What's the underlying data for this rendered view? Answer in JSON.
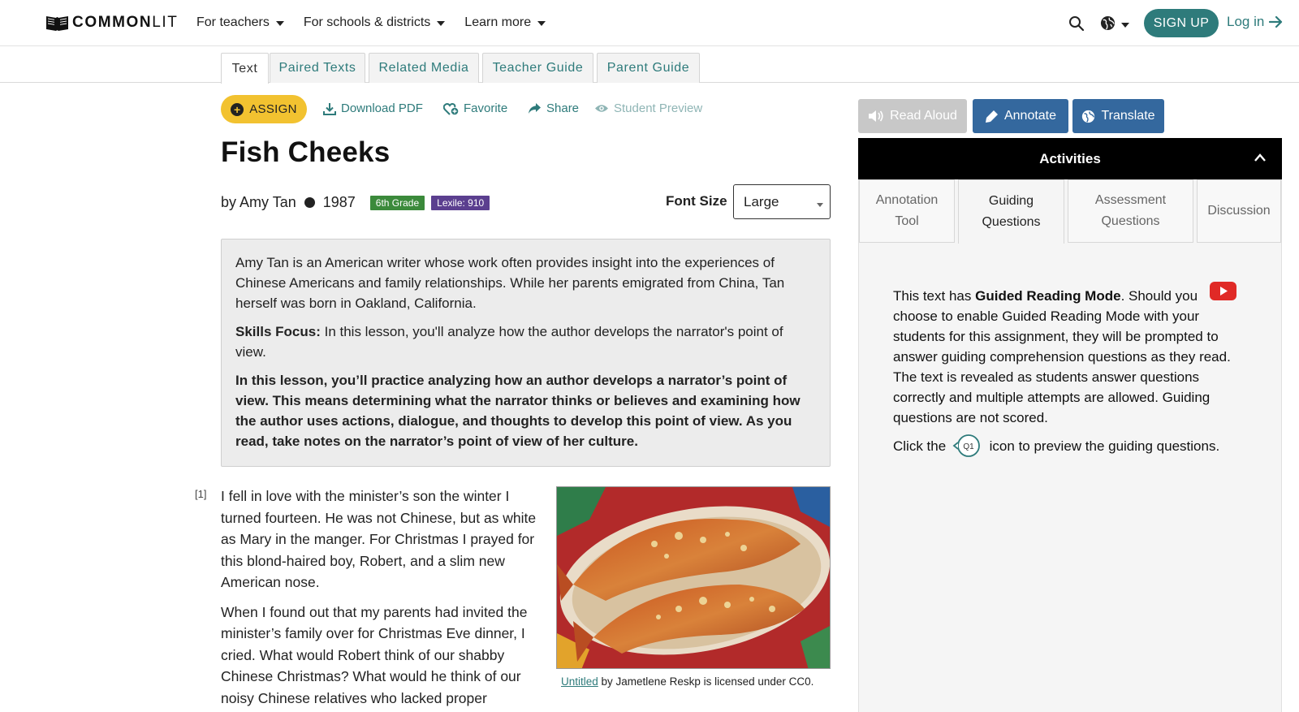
{
  "nav": {
    "logo_bold": "COMMON",
    "logo_light": "LIT",
    "menu": [
      {
        "label": "For teachers"
      },
      {
        "label": "For schools & districts"
      },
      {
        "label": "Learn more"
      }
    ],
    "signup": "SIGN UP",
    "login": "Log in"
  },
  "tabs": [
    {
      "label": "Text"
    },
    {
      "label": "Paired Texts"
    },
    {
      "label": "Related Media"
    },
    {
      "label": "Teacher Guide"
    },
    {
      "label": "Parent Guide"
    }
  ],
  "actions": {
    "assign": "ASSIGN",
    "download": "Download PDF",
    "favorite": "Favorite",
    "share": "Share",
    "preview": "Student Preview"
  },
  "text": {
    "title": "Fish Cheeks",
    "author": "by Amy Tan",
    "year": "1987",
    "grade": "6th Grade",
    "lexile": "Lexile: 910"
  },
  "font_size": {
    "label": "Font Size",
    "value": "Large"
  },
  "intro": {
    "p1": "Amy Tan is an American writer whose work often provides insight into the experiences of Chinese Americans and family relationships. While her parents emigrated from China, Tan herself was born in Oakland, California.",
    "skills_label": "Skills Focus:",
    "skills_text": " In this lesson, you'll analyze how the author develops the narrator's point of view.",
    "p3": "In this lesson, you’ll practice analyzing how an author develops a narrator’s point of view. This means determining what the narrator thinks or believes and examining how the author uses actions, dialogue, and thoughts to develop this point of view. As you read, take notes on the narrator’s point of view of her culture."
  },
  "reading": {
    "para_num": "[1]",
    "p1": "I fell in love with the minister’s son the winter I turned fourteen. He was not Chinese, but as white as Mary in the manger. For Christmas I prayed for this blond-haired boy, Robert, and a slim new American nose.",
    "p2": "When I found out that my parents had invited the minister’s family over for Christmas Eve dinner, I cried. What would Robert think of our shabby Chinese Christmas? What would he think of our noisy Chinese relatives who lacked proper"
  },
  "caption": {
    "link": "Untitled",
    "rest": " by Jametlene Reskp is licensed under CC0."
  },
  "tools": {
    "read_aloud": "Read Aloud",
    "annotate": "Annotate",
    "translate": "Translate"
  },
  "activities": {
    "title": "Activities",
    "tabs": [
      {
        "line1": "Annotation",
        "line2": "Tool"
      },
      {
        "line1": "Guiding",
        "line2": "Questions"
      },
      {
        "line1": "Assessment",
        "line2": "Questions"
      },
      {
        "line1": "Discussion",
        "line2": ""
      }
    ],
    "guide_pre": "This text has ",
    "guide_bold": "Guided Reading Mode",
    "guide_post": ". Should you choose to enable Guided Reading Mode with your students for this assignment, they will be prompted to answer guiding comprehension questions as they read. The text is revealed as students answer questions correctly and multiple attempts are allowed. Guiding questions are not scored.",
    "click_pre": "Click the",
    "q1_label": "Q1",
    "click_post": "icon to preview the guiding questions."
  },
  "colors": {
    "brand_teal": "#2e7b7b",
    "assign_yellow": "#f2c230",
    "tool_blue": "#34689e",
    "grade_green": "#3b8a3b",
    "lexile_purple": "#5b3f8f"
  }
}
